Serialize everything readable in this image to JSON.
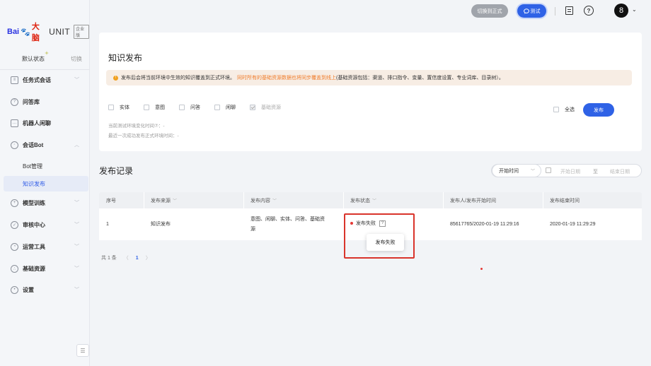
{
  "sidebar": {
    "logo": {
      "bai": "Bai",
      "paw": "du",
      "du": "大脑",
      "unit": "UNIT",
      "badge": "企业版"
    },
    "state_label": "默认状态",
    "state_switch": "切换",
    "items": [
      {
        "label": "任务式会话",
        "icon": "task-icon"
      },
      {
        "label": "问答库",
        "icon": "qa-icon"
      },
      {
        "label": "机器人闲聊",
        "icon": "chat-icon"
      },
      {
        "label": "会话Bot",
        "icon": "bot-icon"
      },
      {
        "label": "模型训练",
        "icon": "train-icon"
      },
      {
        "label": "审核中心",
        "icon": "shield-icon"
      },
      {
        "label": "运营工具",
        "icon": "tools-icon"
      },
      {
        "label": "基础资源",
        "icon": "resource-icon"
      },
      {
        "label": "设置",
        "icon": "settings-icon"
      }
    ],
    "sub_items": [
      "Bot管理",
      "知识发布"
    ],
    "collapse_glyph": "☰"
  },
  "topbar": {
    "switch_label": "切换到正式",
    "test_label": "测试",
    "help_glyph": "?",
    "avatar": "8",
    "avatar_chevron": "⌄"
  },
  "publish_card": {
    "title": "知识发布",
    "notice_part1": "发布后会将当前环境中生效的知识覆盖到正式环境。",
    "notice_part2": "同时所有的基础资源数据也将同步覆盖到线上",
    "notice_part3": "(基础资源包括：渠道、排口指令、变量、置信度设置、专业词库、目录树）。",
    "checkboxes": [
      {
        "label": "实体",
        "disabled": false
      },
      {
        "label": "意图",
        "disabled": false
      },
      {
        "label": "问答",
        "disabled": false
      },
      {
        "label": "闲聊",
        "disabled": false
      },
      {
        "label": "基础资源",
        "disabled": true
      }
    ],
    "meta_change_time": "当前测试环境变化时间⑦：-",
    "meta_last_publish": "最近一次成功发布正式环境时间：-",
    "select_all": "全选",
    "publish_button": "发布"
  },
  "records": {
    "title": "发布记录",
    "date_filter": {
      "type": "开始时间",
      "start_placeholder": "开始日期",
      "separator": "至",
      "end_placeholder": "结束日期"
    },
    "columns": [
      "序号",
      "发布来源",
      "发布内容",
      "发布状态",
      "发布人/发布开始时间",
      "发布结束时间"
    ],
    "sortable": [
      false,
      true,
      true,
      true,
      false,
      false
    ],
    "rows": [
      {
        "index": "1",
        "source": "知识发布",
        "content_line1": "意图、闲聊、实体、问答、基础资",
        "content_line2": "源",
        "status": "发布失败",
        "status_help": "?",
        "publisher_start": "85617765/2020-01-19 11:29:16",
        "end_time": "2020-01-19 11:29:29"
      }
    ],
    "tooltip": "发布失败",
    "pager": {
      "total": "共 1 条",
      "prev": "〈",
      "page": "1",
      "next": "〉"
    }
  }
}
